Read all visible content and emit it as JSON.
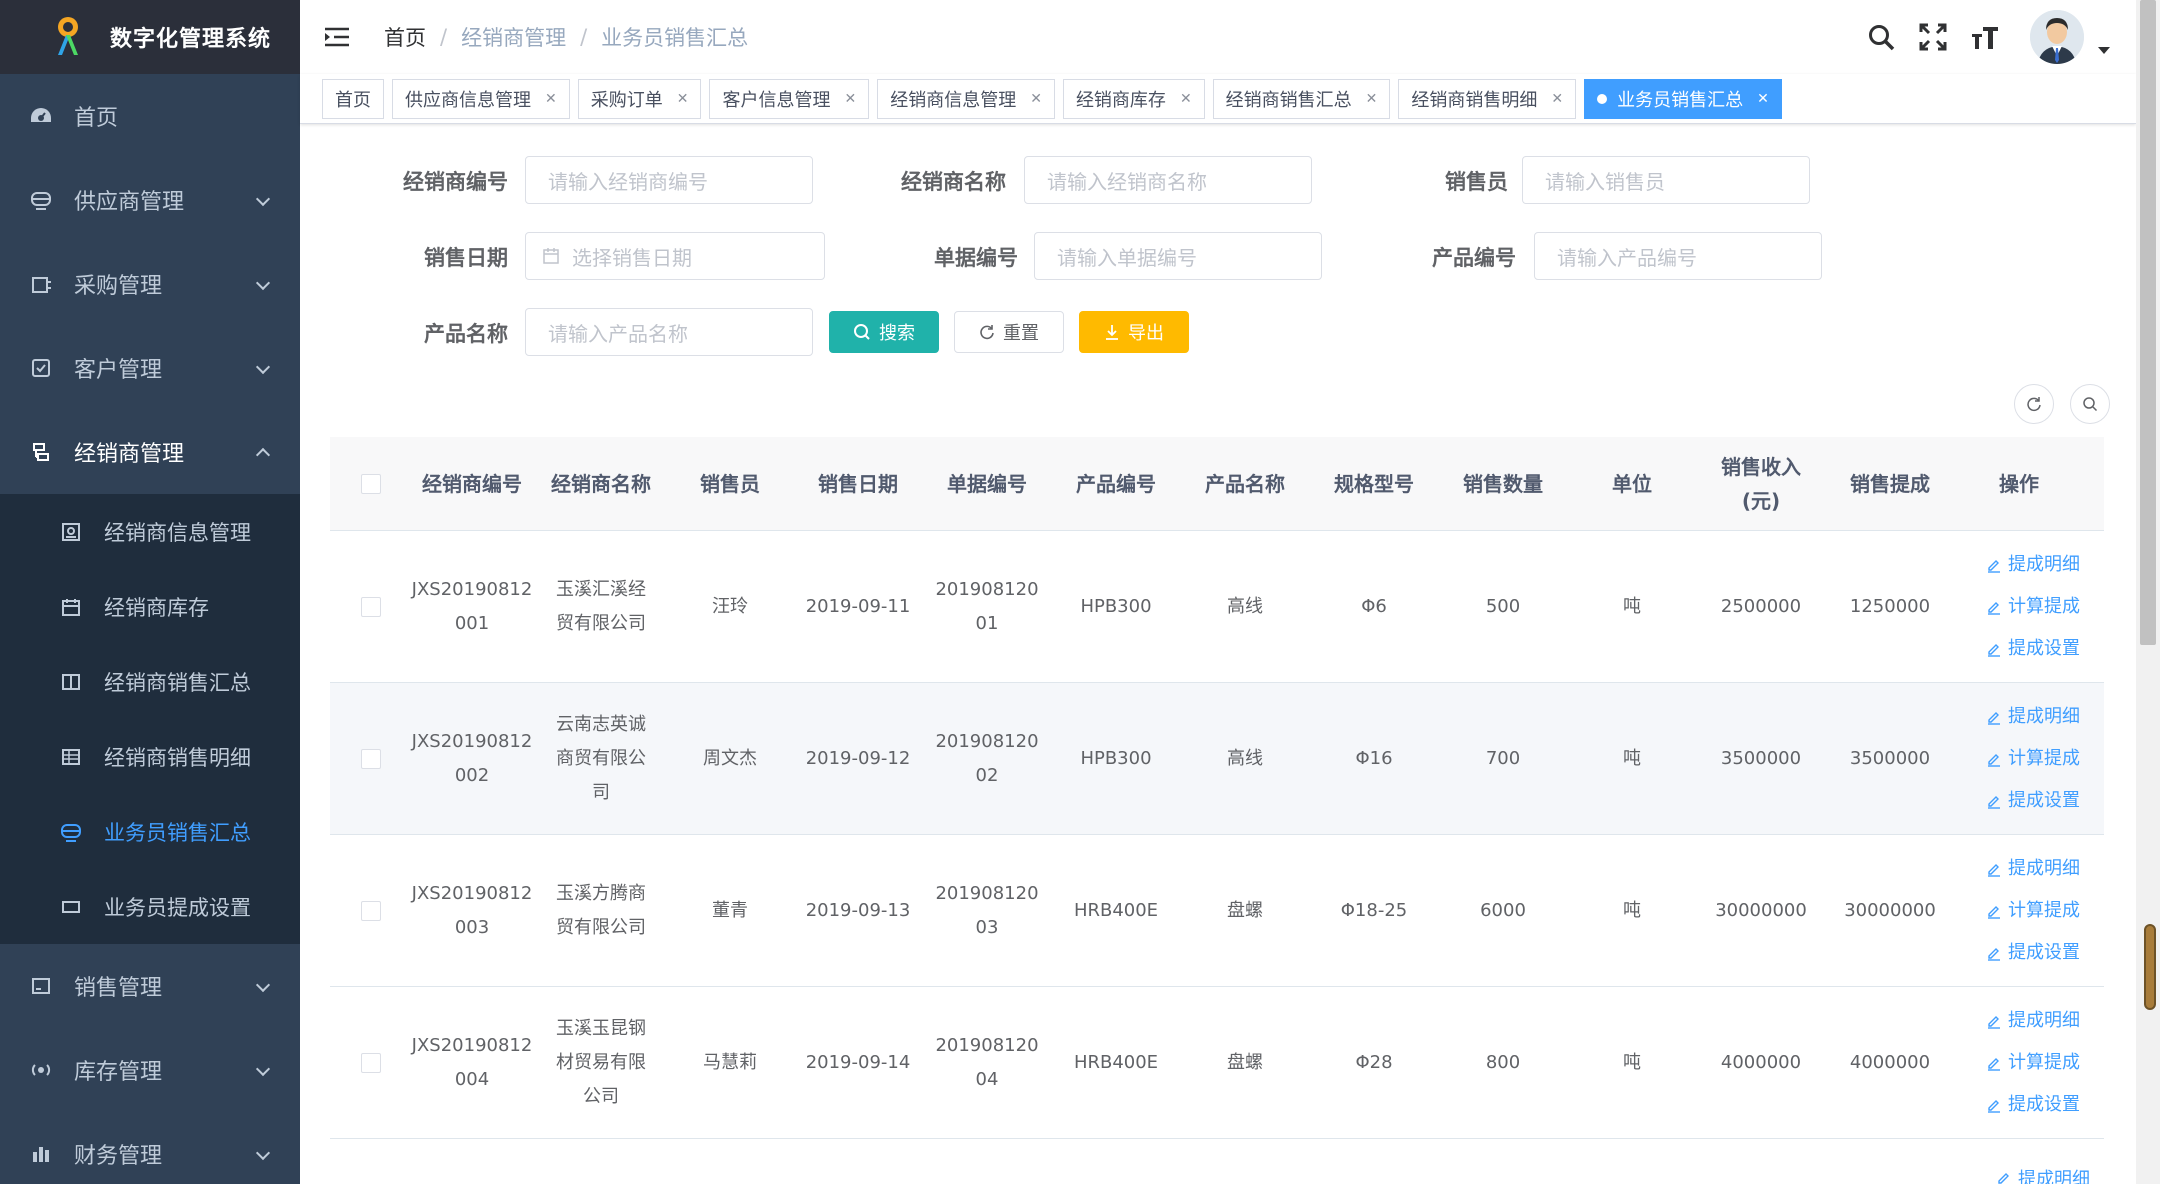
{
  "app": {
    "title": "数字化管理系统"
  },
  "sidebar": {
    "items": [
      {
        "label": "首页",
        "icon": "dashboard-icon"
      },
      {
        "label": "供应商管理",
        "icon": "supplier-icon"
      },
      {
        "label": "采购管理",
        "icon": "purchase-icon"
      },
      {
        "label": "客户管理",
        "icon": "customer-icon"
      },
      {
        "label": "经销商管理",
        "icon": "dealer-icon"
      },
      {
        "label": "销售管理",
        "icon": "sales-icon"
      },
      {
        "label": "库存管理",
        "icon": "inventory-icon"
      },
      {
        "label": "财务管理",
        "icon": "finance-icon"
      }
    ],
    "subitems": [
      {
        "label": "经销商信息管理"
      },
      {
        "label": "经销商库存"
      },
      {
        "label": "经销商销售汇总"
      },
      {
        "label": "经销商销售明细"
      },
      {
        "label": "业务员销售汇总"
      },
      {
        "label": "业务员提成设置"
      }
    ],
    "bg_color": "#304156",
    "active_color": "#409eff"
  },
  "breadcrumb": [
    "首页",
    "经销商管理",
    "业务员销售汇总"
  ],
  "tags": [
    {
      "label": "首页"
    },
    {
      "label": "供应商信息管理"
    },
    {
      "label": "采购订单"
    },
    {
      "label": "客户信息管理"
    },
    {
      "label": "经销商信息管理"
    },
    {
      "label": "经销商库存"
    },
    {
      "label": "经销商销售汇总"
    },
    {
      "label": "经销商销售明细"
    },
    {
      "label": "业务员销售汇总"
    }
  ],
  "form": {
    "dealer_code": {
      "label": "经销商编号",
      "placeholder": "请输入经销商编号"
    },
    "dealer_name": {
      "label": "经销商名称",
      "placeholder": "请输入经销商名称"
    },
    "salesman": {
      "label": "销售员",
      "placeholder": "请输入销售员"
    },
    "sale_date": {
      "label": "销售日期",
      "placeholder": "选择销售日期"
    },
    "doc_no": {
      "label": "单据编号",
      "placeholder": "请输入单据编号"
    },
    "product_code": {
      "label": "产品编号",
      "placeholder": "请输入产品编号"
    },
    "product_name": {
      "label": "产品名称",
      "placeholder": "请输入产品名称"
    },
    "search_label": "搜索",
    "reset_label": "重置",
    "export_label": "导出"
  },
  "table": {
    "headers": [
      "经销商编号",
      "经销商名称",
      "销售员",
      "销售日期",
      "单据编号",
      "产品编号",
      "产品名称",
      "规格型号",
      "销售数量",
      "单位",
      "销售收入",
      "销售提成",
      "操作"
    ],
    "header_unit": "(元)",
    "ops": [
      "提成明细",
      "计算提成",
      "提成设置"
    ],
    "rows": [
      {
        "code1": "JXS20190812",
        "code2": "001",
        "name": [
          "玉溪汇溪经",
          "贸有限公司"
        ],
        "salesman": "汪玲",
        "date": "2019-09-11",
        "doc1": "201908120",
        "doc2": "01",
        "pcode": "HPB300",
        "pname": "高线",
        "spec": "Φ6",
        "qty": "500",
        "unit": "吨",
        "revenue": "2500000",
        "commission": "1250000"
      },
      {
        "code1": "JXS20190812",
        "code2": "002",
        "name": [
          "云南志英诚",
          "商贸有限公",
          "司"
        ],
        "salesman": "周文杰",
        "date": "2019-09-12",
        "doc1": "201908120",
        "doc2": "02",
        "pcode": "HPB300",
        "pname": "高线",
        "spec": "Φ16",
        "qty": "700",
        "unit": "吨",
        "revenue": "3500000",
        "commission": "3500000"
      },
      {
        "code1": "JXS20190812",
        "code2": "003",
        "name": [
          "玉溪方腾商",
          "贸有限公司"
        ],
        "salesman": "董青",
        "date": "2019-09-13",
        "doc1": "201908120",
        "doc2": "03",
        "pcode": "HRB400E",
        "pname": "盘螺",
        "spec": "Φ18-25",
        "qty": "6000",
        "unit": "吨",
        "revenue": "30000000",
        "commission": "30000000"
      },
      {
        "code1": "JXS20190812",
        "code2": "004",
        "name": [
          "玉溪玉昆钢",
          "材贸易有限",
          "公司"
        ],
        "salesman": "马慧莉",
        "date": "2019-09-14",
        "doc1": "201908120",
        "doc2": "04",
        "pcode": "HRB400E",
        "pname": "盘螺",
        "spec": "Φ28",
        "qty": "800",
        "unit": "吨",
        "revenue": "4000000",
        "commission": "4000000"
      }
    ]
  }
}
